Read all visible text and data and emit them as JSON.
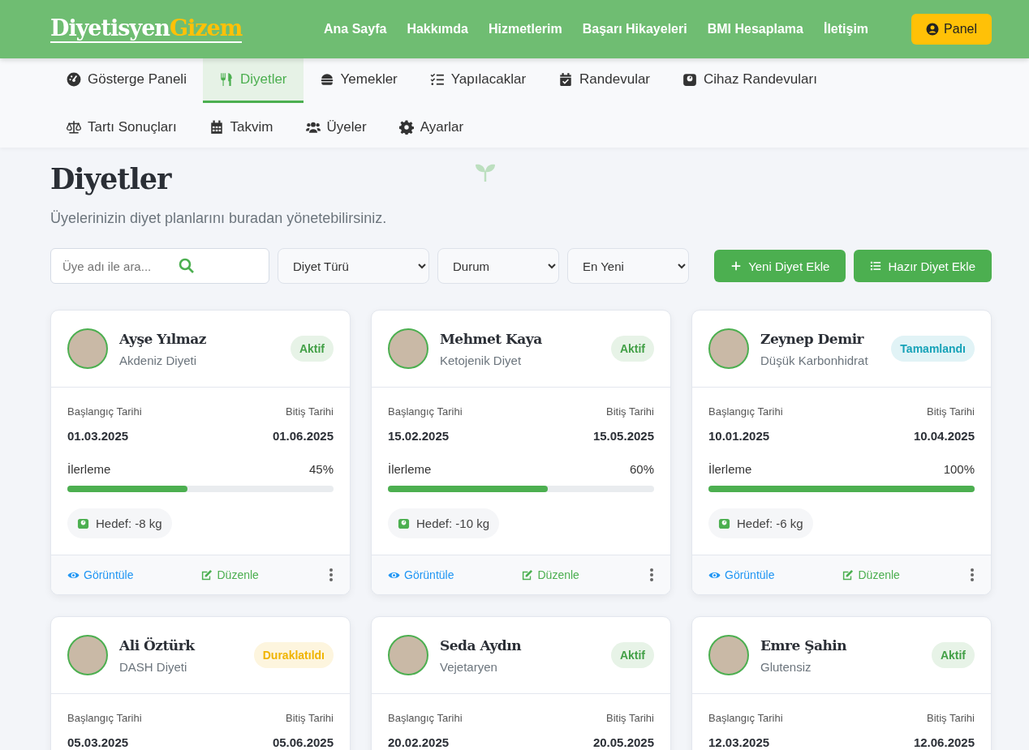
{
  "brand": {
    "first": "Diyetisyen",
    "second": "Gizem"
  },
  "nav": [
    "Ana Sayfa",
    "Hakkımda",
    "Hizmetlerim",
    "Başarı Hikayeleri",
    "BMI Hesaplama",
    "İletişim"
  ],
  "panel_button": "Panel",
  "tabs": [
    {
      "label": "Gösterge Paneli",
      "selected": false
    },
    {
      "label": "Diyetler",
      "selected": true
    },
    {
      "label": "Yemekler",
      "selected": false
    },
    {
      "label": "Yapılacaklar",
      "selected": false
    },
    {
      "label": "Randevular",
      "selected": false
    },
    {
      "label": "Cihaz Randevuları",
      "selected": false
    },
    {
      "label": "Tartı Sonuçları",
      "selected": false
    },
    {
      "label": "Takvim",
      "selected": false
    },
    {
      "label": "Üyeler",
      "selected": false
    },
    {
      "label": "Ayarlar",
      "selected": false
    }
  ],
  "page": {
    "title": "Diyetler",
    "subtitle": "Üyelerinizin diyet planlarını buradan yönetebilirsiniz."
  },
  "filters": {
    "search_placeholder": "Üye adı ile ara...",
    "selects": [
      "Diyet Türü",
      "Durum",
      "En Yeni"
    ]
  },
  "actions": [
    "Yeni Diyet Ekle",
    "Hazır Diyet Ekle"
  ],
  "cards": [
    {
      "name": "Ayşe Yılmaz",
      "diet": "Akdeniz Diyeti",
      "status": "Aktif",
      "color": "#43a047",
      "start_label": "Başlangıç Tarihi",
      "start": "01.03.2025",
      "end_label": "Bitiş Tarihi",
      "end": "01.06.2025",
      "progress_label": "İlerleme",
      "progress_text": "45%",
      "level": 0.45,
      "goal": "Hedef: -8 kg",
      "view": "Görüntüle",
      "edit": "Düzenle"
    },
    {
      "name": "Mehmet Kaya",
      "diet": "Ketojenik Diyet",
      "status": "Aktif",
      "color": "#43a047",
      "start_label": "Başlangıç Tarihi",
      "start": "15.02.2025",
      "end_label": "Bitiş Tarihi",
      "end": "15.05.2025",
      "progress_label": "İlerleme",
      "progress_text": "60%",
      "level": 0.6,
      "goal": "Hedef: -10 kg",
      "view": "Görüntüle",
      "edit": "Düzenle"
    },
    {
      "name": "Zeynep Demir",
      "diet": "Düşük Karbonhidrat",
      "status": "Tamamlandı",
      "color": "#17a2b8",
      "start_label": "Başlangıç Tarihi",
      "start": "10.01.2025",
      "end_label": "Bitiş Tarihi",
      "end": "10.04.2025",
      "progress_label": "İlerleme",
      "progress_text": "100%",
      "level": 1,
      "goal": "Hedef: -6 kg",
      "view": "Görüntüle",
      "edit": "Düzenle"
    },
    {
      "name": "Ali Öztürk",
      "diet": "DASH Diyeti",
      "status": "Duraklatıldı",
      "color": "#f0b400",
      "start_label": "Başlangıç Tarihi",
      "start": "05.03.2025",
      "end_label": "Bitiş Tarihi",
      "end": "05.06.2025"
    },
    {
      "name": "Seda Aydın",
      "diet": "Vejetaryen",
      "status": "Aktif",
      "color": "#43a047",
      "start_label": "Başlangıç Tarihi",
      "start": "20.02.2025",
      "end_label": "Bitiş Tarihi",
      "end": "20.05.2025"
    },
    {
      "name": "Emre Şahin",
      "diet": "Glutensiz",
      "status": "Aktif",
      "color": "#43a047",
      "start_label": "Başlangıç Tarihi",
      "start": "12.03.2025",
      "end_label": "Bitiş Tarihi",
      "end": "12.06.2025"
    }
  ]
}
